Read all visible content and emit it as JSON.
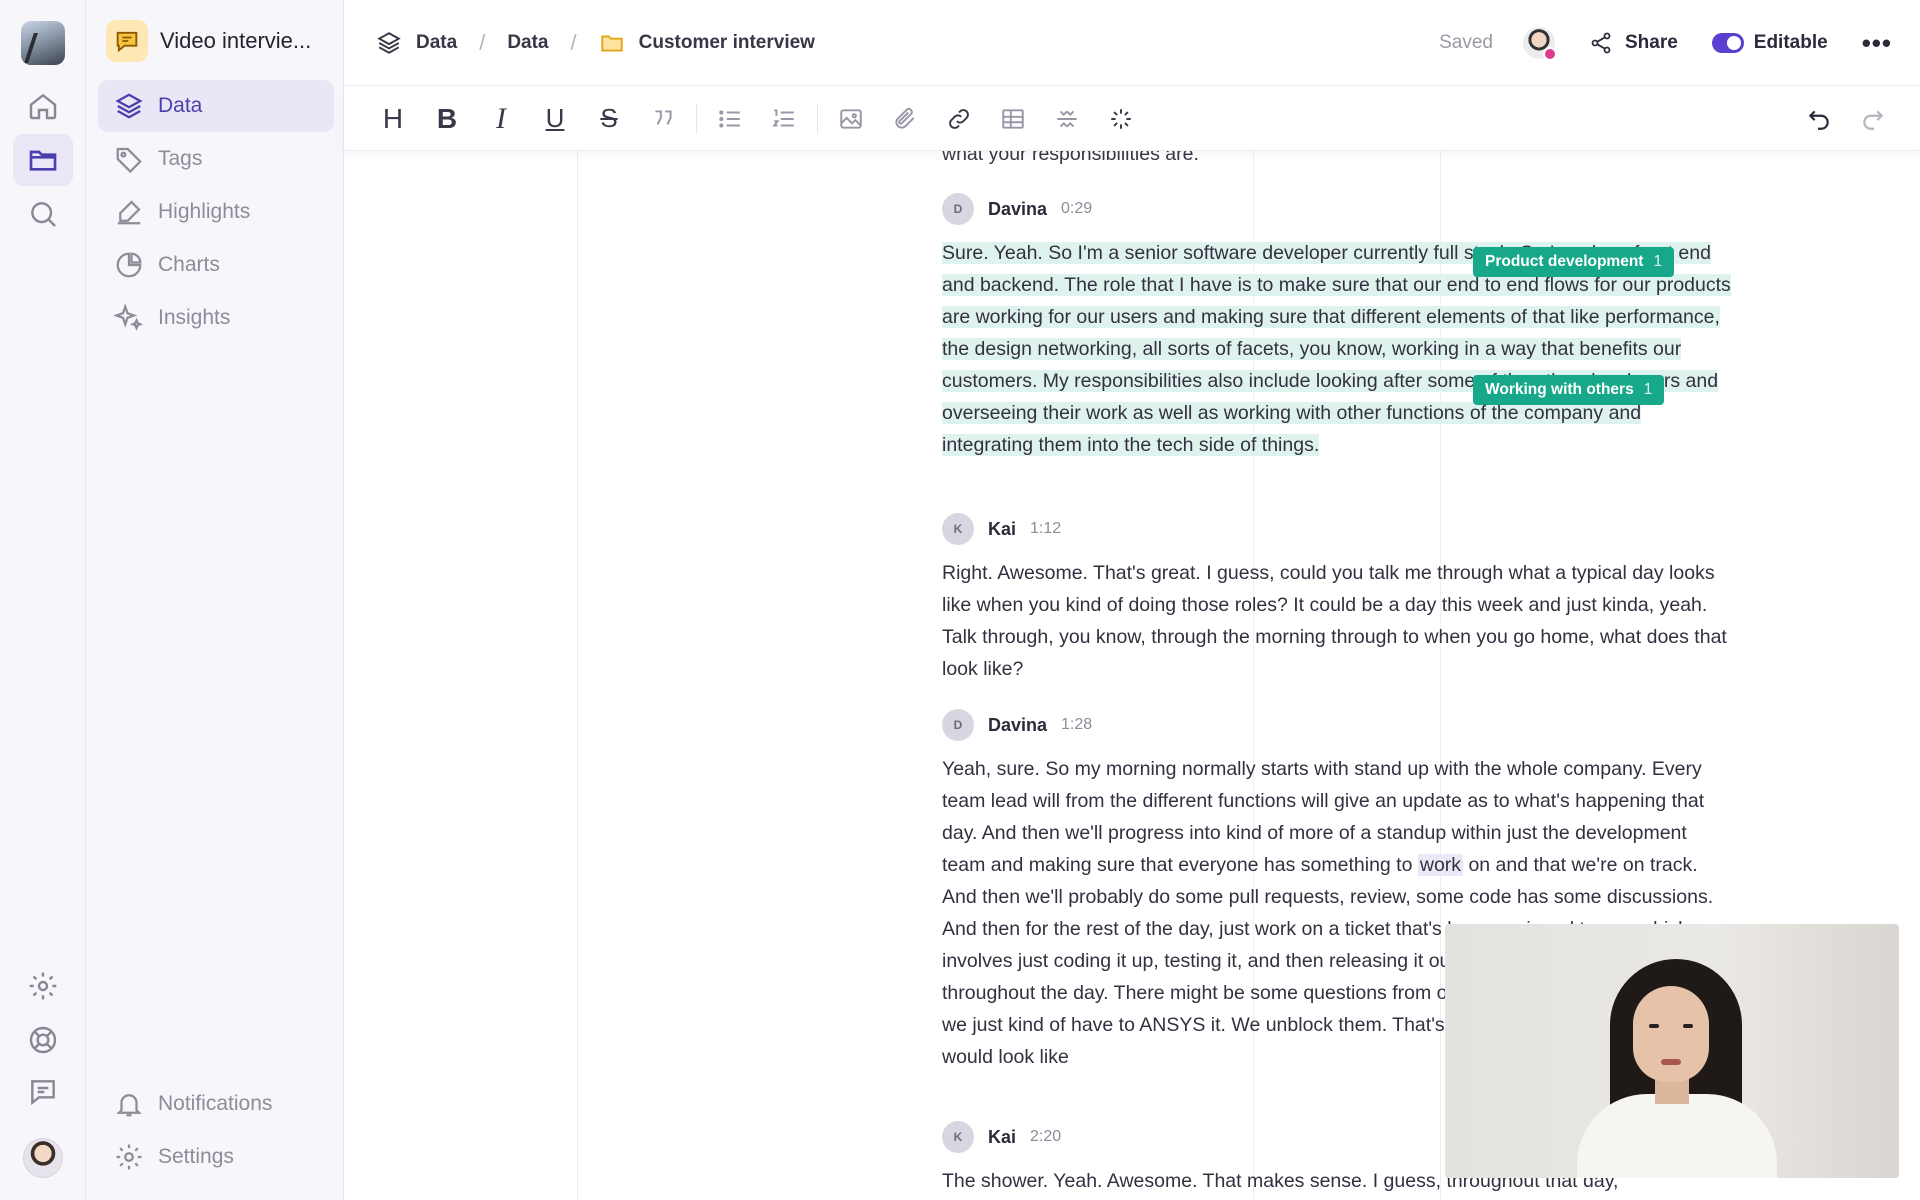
{
  "project": {
    "title": "Video intervie..."
  },
  "nav": {
    "items": [
      {
        "label": "Data"
      },
      {
        "label": "Tags"
      },
      {
        "label": "Highlights"
      },
      {
        "label": "Charts"
      },
      {
        "label": "Insights"
      }
    ],
    "bottom": [
      {
        "label": "Notifications"
      },
      {
        "label": "Settings"
      }
    ]
  },
  "breadcrumb": [
    "Data",
    "Data",
    "Customer interview"
  ],
  "header": {
    "saved": "Saved",
    "share": "Share",
    "editable": "Editable",
    "more": "•••"
  },
  "toolbar": {
    "heading": "H",
    "bold": "B",
    "italic": "I",
    "underline": "U",
    "strike": "S"
  },
  "transcript": {
    "cut_text": "what your responsibilities are.",
    "blocks": [
      {
        "initial": "D",
        "speaker": "Davina",
        "time": "0:29",
        "text": "Sure. Yeah. So I'm a senior software developer currently full stack. So I work on front end and backend. The role that I have is to make sure that our end to end flows for our products are working for our users and making sure that different elements of that like performance, the design networking, all sorts of facets, you know, working in a way that benefits our customers. My responsibilities also include looking after some of the other developers and overseeing their work as well as working with other functions of the company and integrating them into the tech side of things."
      },
      {
        "initial": "K",
        "speaker": "Kai",
        "time": "1:12",
        "text": "Right. Awesome. That's great. I guess, could you talk me through what a typical day looks like when you kind of doing those roles? It could be a day this week and just kinda, yeah. Talk through, you know, through the morning through to when you go home, what does that look like?"
      },
      {
        "initial": "D",
        "speaker": "Davina",
        "time": "1:28",
        "text_before": "Yeah, sure. So my morning normally starts with stand up with the whole company. Every team lead will from the different functions will give an update as to what's happening that day. And then we'll progress into kind of more of a standup within just the development team and making sure that everyone has something to ",
        "text_word": "work",
        "text_after": " on and that we're on track. And then we'll probably do some pull requests, review, some code has some discussions. And then for the rest of the day, just work on a ticket that's been assigned to me, which involves just coding it up, testing it, and then releasing it out into development of production throughout the day. There might be some questions from other people in the company that we just kind of have to ANSYS it. We unblock them. That's kind of like what a typical day would look like"
      },
      {
        "initial": "K",
        "speaker": "Kai",
        "time": "2:20",
        "text": "The shower. Yeah. Awesome. That makes sense. I guess, throughout that day,"
      }
    ]
  },
  "tags": [
    {
      "label": "Product development",
      "count": "1"
    },
    {
      "label": "Working with others",
      "count": "1"
    }
  ],
  "colors": {
    "accent": "#5a3fd1",
    "tag": "#17a88a",
    "highlight": "#dff3ee"
  }
}
